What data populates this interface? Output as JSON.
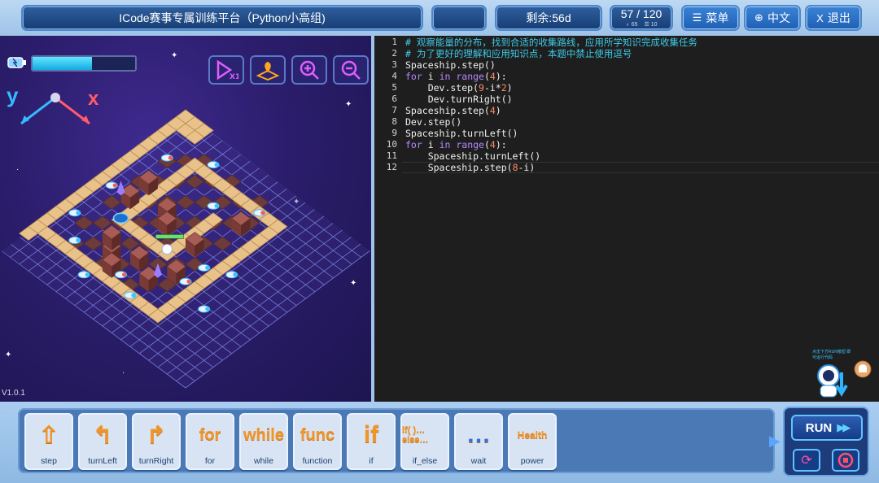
{
  "header": {
    "title": "ICode赛事专属训练平台（Python小高组)",
    "remaining": "剩余:56d",
    "progress": {
      "main": "57 / 120",
      "sub_left": "♁ 65",
      "sub_right": "☰ 10"
    },
    "menu_label": "菜单",
    "lang_label": "中文",
    "exit_label": "退出"
  },
  "game": {
    "version": "V1.0.1",
    "axis_y": "y",
    "axis_x": "x",
    "energy_fraction": 0.58,
    "tools": [
      "speed-x1-icon",
      "map-location-icon",
      "zoom-in-icon",
      "zoom-out-icon"
    ]
  },
  "code": {
    "line_numbers": [
      "1",
      "2",
      "3",
      "4",
      "5",
      "6",
      "7",
      "8",
      "9",
      "10",
      "11",
      "12"
    ],
    "lines": [
      [
        {
          "t": "# 观察能量的分布，找到合适的收集路线，应用所学知识完成收集任务",
          "c": "cm"
        }
      ],
      [
        {
          "t": "# 为了更好的理解和应用知识点，本题中禁止使用逗号",
          "c": "cm"
        }
      ],
      [
        {
          "t": "Spaceship.step()",
          "c": ""
        }
      ],
      [
        {
          "t": "for",
          "c": "kw"
        },
        {
          "t": " i ",
          "c": ""
        },
        {
          "t": "in",
          "c": "kw"
        },
        {
          "t": " ",
          "c": ""
        },
        {
          "t": "range",
          "c": "kw"
        },
        {
          "t": "(",
          "c": ""
        },
        {
          "t": "4",
          "c": "nm"
        },
        {
          "t": "):",
          "c": ""
        }
      ],
      [
        {
          "t": "    Dev.step(",
          "c": ""
        },
        {
          "t": "9",
          "c": "nm"
        },
        {
          "t": "-i*",
          "c": ""
        },
        {
          "t": "2",
          "c": "nm"
        },
        {
          "t": ")",
          "c": ""
        }
      ],
      [
        {
          "t": "    Dev.turnRight()",
          "c": ""
        }
      ],
      [
        {
          "t": "Spaceship.step(",
          "c": ""
        },
        {
          "t": "4",
          "c": "nm"
        },
        {
          "t": ")",
          "c": ""
        }
      ],
      [
        {
          "t": "Dev.step()",
          "c": ""
        }
      ],
      [
        {
          "t": "Spaceship.turnLeft()",
          "c": ""
        }
      ],
      [
        {
          "t": "for",
          "c": "kw"
        },
        {
          "t": " i ",
          "c": ""
        },
        {
          "t": "in",
          "c": "kw"
        },
        {
          "t": " ",
          "c": ""
        },
        {
          "t": "range",
          "c": "kw"
        },
        {
          "t": "(",
          "c": ""
        },
        {
          "t": "4",
          "c": "nm"
        },
        {
          "t": "):",
          "c": ""
        }
      ],
      [
        {
          "t": "    Spaceship.turnLeft()",
          "c": ""
        }
      ],
      [
        {
          "t": "    Spaceship.step(",
          "c": ""
        },
        {
          "t": "8",
          "c": "nm"
        },
        {
          "t": "-i)",
          "c": ""
        }
      ]
    ],
    "robot_tip": "点击下方RUN按钮 即可运行代码"
  },
  "blocks": [
    {
      "label": "step",
      "icon": "step-icon",
      "glyph": "⇧"
    },
    {
      "label": "turnLeft",
      "icon": "turn-left-icon",
      "glyph": "↰"
    },
    {
      "label": "turnRight",
      "icon": "turn-right-icon",
      "glyph": "↱"
    },
    {
      "label": "for",
      "icon": "for-icon",
      "glyph": "for"
    },
    {
      "label": "while",
      "icon": "while-icon",
      "glyph": "while"
    },
    {
      "label": "function",
      "icon": "function-icon",
      "glyph": "func"
    },
    {
      "label": "if",
      "icon": "if-icon",
      "glyph": "if"
    },
    {
      "label": "if_else",
      "icon": "if-else-icon",
      "glyph": "if( )… else…"
    },
    {
      "label": "wait",
      "icon": "wait-icon",
      "glyph": "…"
    },
    {
      "label": "power",
      "icon": "power-icon",
      "glyph": "Health"
    }
  ],
  "run": {
    "label": "RUN"
  }
}
